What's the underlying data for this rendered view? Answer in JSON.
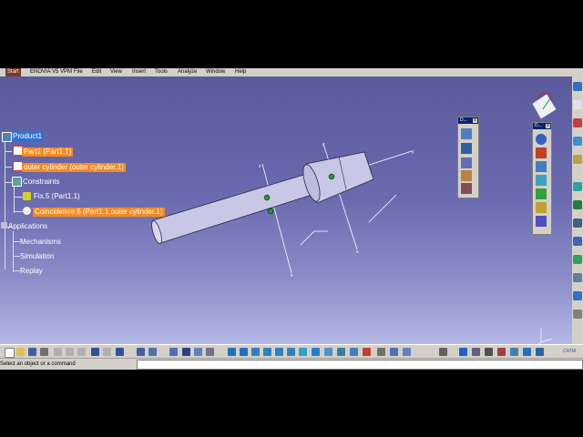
{
  "menu": {
    "start": "Start",
    "items": [
      "ENOVIA V5 VPM",
      "File",
      "Edit",
      "View",
      "Insert",
      "Tools",
      "Analyze",
      "Window",
      "Help"
    ]
  },
  "tree": {
    "root": "Product1",
    "part1": "Part1 (Part1.1)",
    "outer": "outer cylinder (outer cylinder.1)",
    "constraints": "Constraints",
    "fix": "Fix.5 (Part1.1)",
    "coincidence": "Coincidence.6 (Part1.1,outer cylinder.1)",
    "applications": "Applications",
    "mechanisms": "Mechanisms",
    "simulation": "Simulation",
    "replay": "Replay"
  },
  "toolbars": {
    "left_title": "D...",
    "right_title": "D..."
  },
  "axes": {
    "x": "x",
    "y": "y",
    "z": "z"
  },
  "status": {
    "prompt": "Select an object or a command",
    "command_value": ""
  },
  "colors": {
    "viewport_top": "#5a5a9c",
    "viewport_bottom": "#b4b8e4",
    "selection": "#f58a1f",
    "root_highlight": "#3470d0",
    "model": "#c8c8e6"
  },
  "icons": [
    "product-icon",
    "part-icon",
    "constraints-icon",
    "fix-icon",
    "coincidence-icon",
    "applications-icon",
    "compass-icon",
    "catia-logo-icon"
  ]
}
